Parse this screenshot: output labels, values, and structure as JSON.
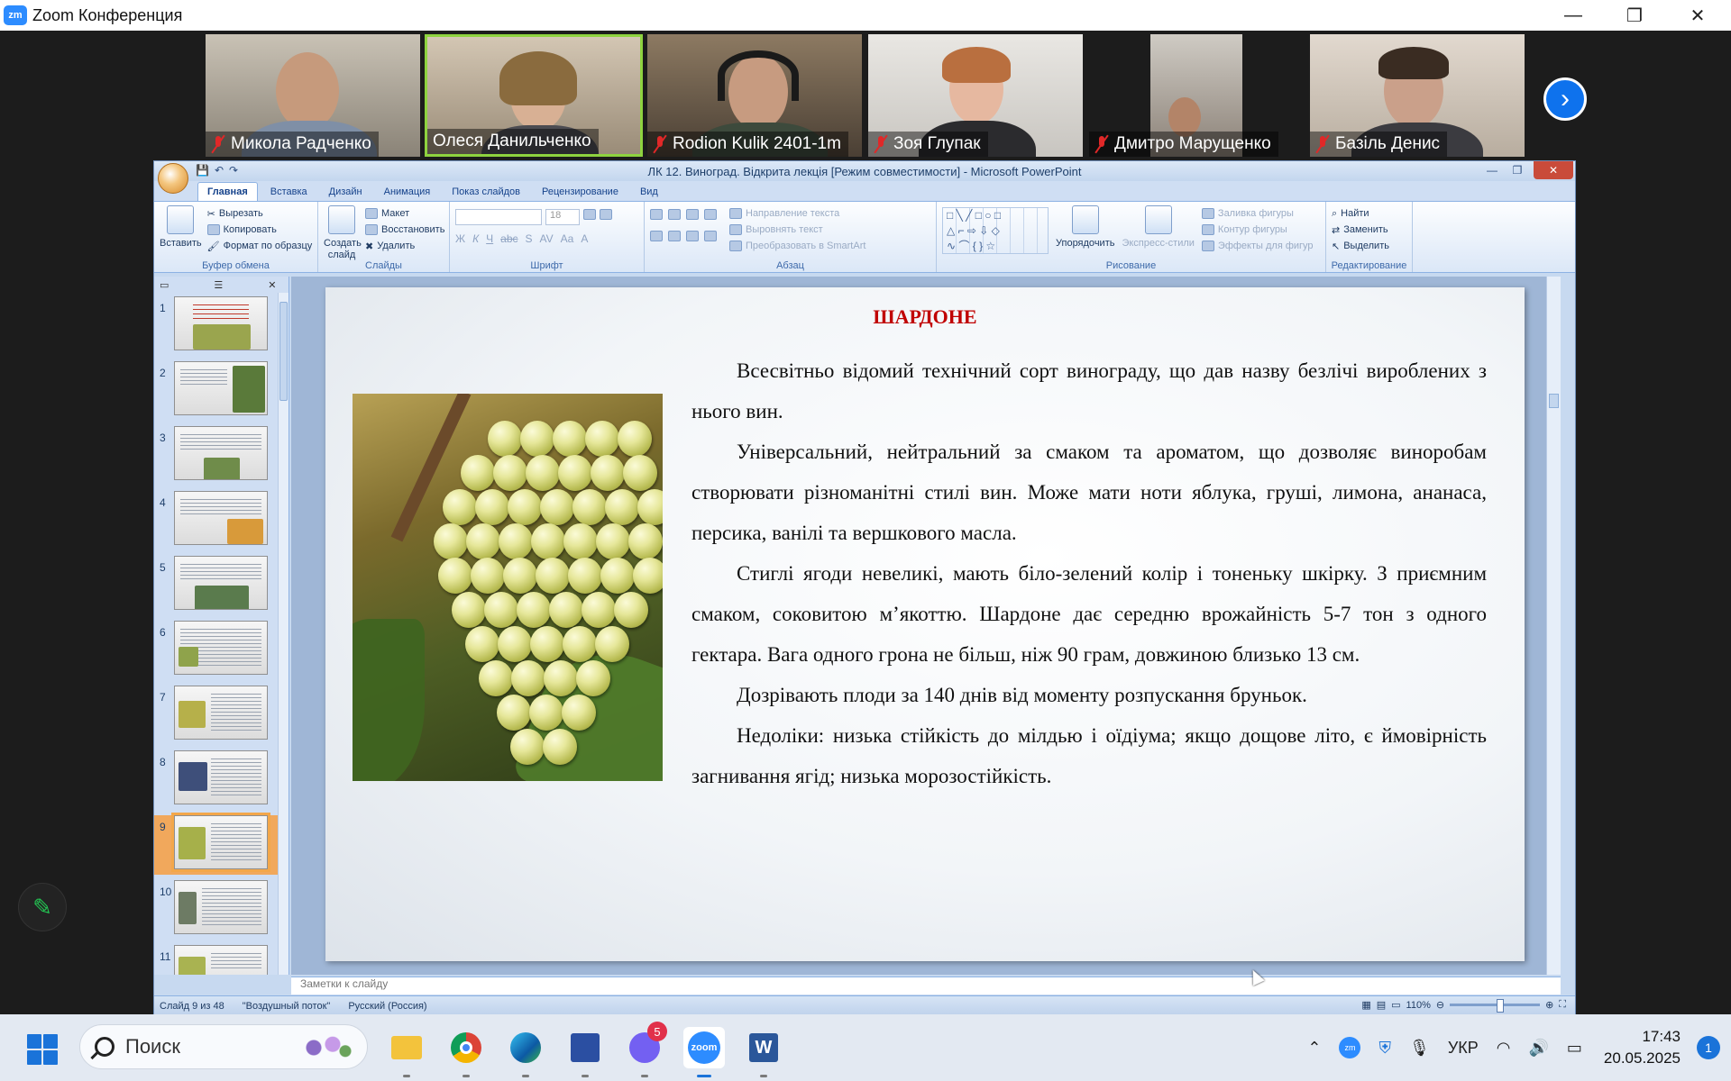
{
  "zoom": {
    "logo": "zm",
    "title": "Zoom Конференция",
    "participants": [
      {
        "name": "Микола Радченко",
        "muted": true
      },
      {
        "name": "Олеся Данильченко",
        "muted": false
      },
      {
        "name": "Rodion Kulik 2401-1m",
        "muted": true
      },
      {
        "name": "Зоя Глупак",
        "muted": true
      },
      {
        "name": "Дмитро Марущенко",
        "muted": true
      },
      {
        "name": "Базіль Денис",
        "muted": true
      }
    ]
  },
  "powerpoint": {
    "title": "ЛК 12. Виноград. Відкрита лекція [Режим совместимости] - Microsoft PowerPoint",
    "tabs": [
      "Главная",
      "Вставка",
      "Дизайн",
      "Анимация",
      "Показ слайдов",
      "Рецензирование",
      "Вид"
    ],
    "ribbon": {
      "clipboard": {
        "group": "Буфер обмена",
        "paste": "Вставить",
        "cut": "Вырезать",
        "copy": "Копировать",
        "format_painter": "Формат по образцу"
      },
      "slides": {
        "group": "Слайды",
        "new_slide": "Создать слайд",
        "layout": "Макет",
        "reset": "Восстановить",
        "delete": "Удалить"
      },
      "font": {
        "group": "Шрифт",
        "size": "18"
      },
      "paragraph": {
        "group": "Абзац",
        "text_direction": "Направление текста",
        "align_text": "Выровнять текст",
        "smartart": "Преобразовать в SmartArt"
      },
      "drawing": {
        "group": "Рисование",
        "arrange": "Упорядочить",
        "quick_styles": "Экспресс-стили",
        "shape_fill": "Заливка фигуры",
        "shape_outline": "Контур фигуры",
        "shape_effects": "Эффекты для фигур"
      },
      "editing": {
        "group": "Редактирование",
        "find": "Найти",
        "replace": "Заменить",
        "select": "Выделить"
      }
    },
    "slide_numbers": [
      "1",
      "2",
      "3",
      "4",
      "5",
      "6",
      "7",
      "8",
      "9",
      "10",
      "11"
    ],
    "slide": {
      "title": "ШАРДОНЕ",
      "paragraphs": [
        "Всесвітньо відомий технічний сорт винограду, що дав назву безлічі вироблених з нього вин.",
        "Універсальний, нейтральний за смаком та ароматом, що дозволяє виноробам створювати різноманітні стилі вин. Може мати ноти яблука, груші, лимона, ананаса, персика, ванілі та вершкового масла.",
        "Стиглі ягоди невеликі, мають біло-зелений колір і тоненьку шкірку. З приємним смаком, соковитою м’якоттю. Шардоне дає середню врожайність 5-7 тон з одного гектара. Вага одного грона не більш, ніж 90 грам, довжиною близько 13 см.",
        "Дозрівають плоди за 140 днів від моменту розпускання бруньок.",
        "Недоліки: низька стійкість до мілдью і оїдіума; якщо дощове літо, є ймовірність загнивання ягід; низька морозостійкість."
      ]
    },
    "notes_placeholder": "Заметки к слайду",
    "status": {
      "slide": "Слайд 9 из 48",
      "theme": "\"Воздушный поток\"",
      "language": "Русский (Россия)",
      "zoom": "110%"
    }
  },
  "taskbar": {
    "search_placeholder": "Поиск",
    "viber_badge": "5",
    "language": "УКР",
    "time": "17:43",
    "date": "20.05.2025",
    "notifications": "1"
  }
}
